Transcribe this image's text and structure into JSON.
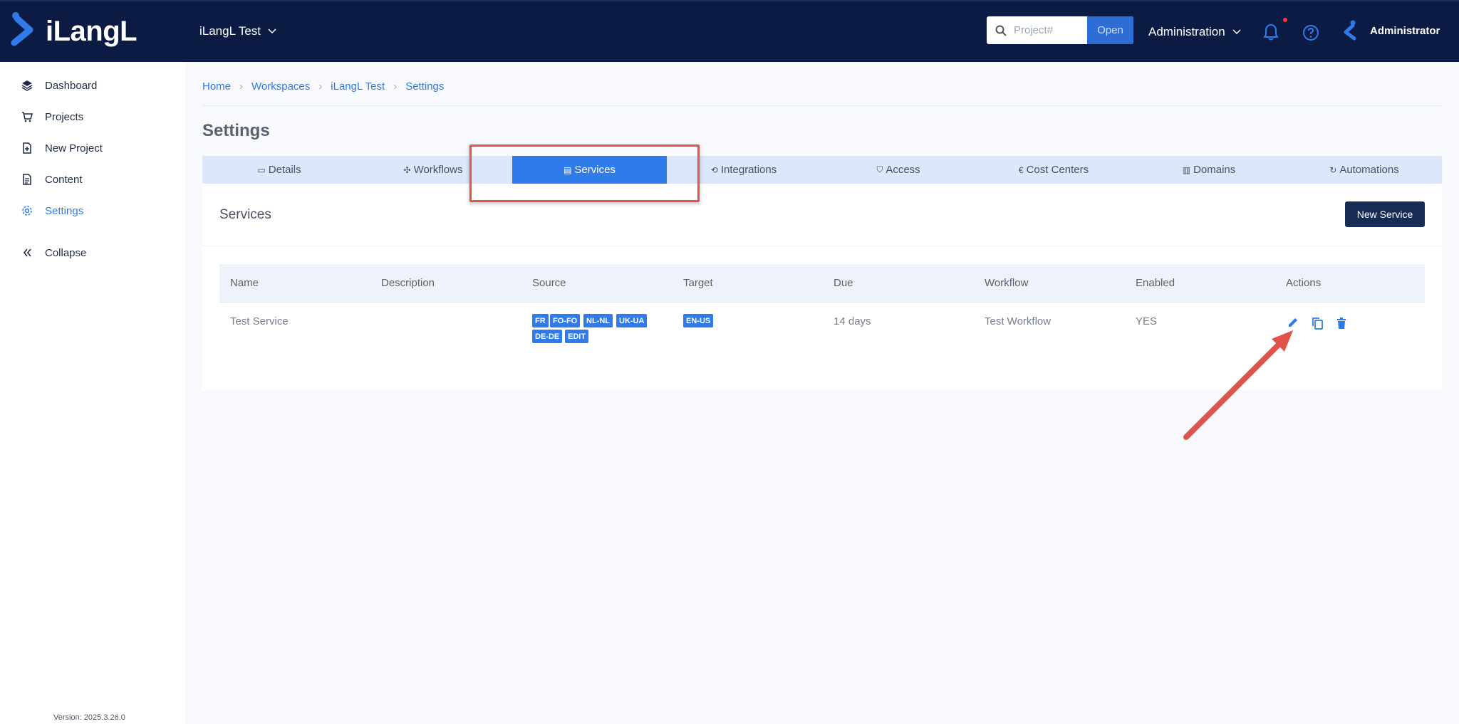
{
  "header": {
    "logo_text": "iLangL",
    "workspace": "iLangL Test",
    "search_placeholder": "Project#",
    "open_label": "Open",
    "admin_menu": "Administration",
    "user_name": "Administrator"
  },
  "sidebar": {
    "items": [
      {
        "label": "Dashboard",
        "icon": "layers-icon"
      },
      {
        "label": "Projects",
        "icon": "cart-icon"
      },
      {
        "label": "New Project",
        "icon": "file-plus-icon"
      },
      {
        "label": "Content",
        "icon": "document-icon"
      },
      {
        "label": "Settings",
        "icon": "gear-icon"
      }
    ],
    "collapse_label": "Collapse",
    "version": "Version: 2025.3.26.0"
  },
  "breadcrumb": [
    "Home",
    "Workspaces",
    "iLangL Test",
    "Settings"
  ],
  "page_title": "Settings",
  "tabs": [
    {
      "label": "Details",
      "icon": "▭"
    },
    {
      "label": "Workflows",
      "icon": "✣"
    },
    {
      "label": "Services",
      "icon": "▤"
    },
    {
      "label": "Integrations",
      "icon": "⟲"
    },
    {
      "label": "Access",
      "icon": "⛉"
    },
    {
      "label": "Cost Centers",
      "icon": "€"
    },
    {
      "label": "Domains",
      "icon": "▥"
    },
    {
      "label": "Automations",
      "icon": "↻"
    }
  ],
  "panel": {
    "title": "Services",
    "new_button": "New Service"
  },
  "table": {
    "columns": [
      "Name",
      "Description",
      "Source",
      "Target",
      "Due",
      "Workflow",
      "Enabled",
      "Actions"
    ],
    "rows": [
      {
        "name": "Test Service",
        "description": "",
        "source": [
          "FR",
          "FO-FO",
          "NL-NL",
          "UK-UA",
          "DE-DE",
          "EDIT"
        ],
        "target": [
          "EN-US"
        ],
        "due": "14 days",
        "workflow": "Test Workflow",
        "enabled": "YES"
      }
    ]
  },
  "colors": {
    "topbar": "#0b1b44",
    "accent": "#2f7bea",
    "annotation": "#e0524a"
  }
}
